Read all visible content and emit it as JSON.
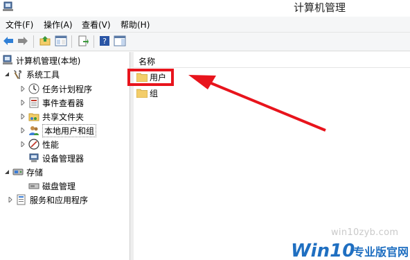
{
  "window": {
    "title": "计算机管理"
  },
  "menu": {
    "file": "文件(F)",
    "action": "操作(A)",
    "view": "查看(V)",
    "help": "帮助(H)"
  },
  "tree": {
    "root": "计算机管理(本地)",
    "system_tools": "系统工具",
    "task_scheduler": "任务计划程序",
    "event_viewer": "事件查看器",
    "shared_folders": "共享文件夹",
    "local_users_groups": "本地用户和组",
    "performance": "性能",
    "device_manager": "设备管理器",
    "storage": "存储",
    "disk_management": "磁盘管理",
    "services_apps": "服务和应用程序"
  },
  "list": {
    "column_name": "名称",
    "items": [
      "用户",
      "组"
    ]
  },
  "watermark": {
    "site": "win10zyb.com",
    "logo_prefix": "Win10",
    "logo_suffix": "专业版官网"
  },
  "colors": {
    "annotation": "#e8141c",
    "folder": "#f3cd6a",
    "watermark_blue": "#1f6fc1"
  }
}
